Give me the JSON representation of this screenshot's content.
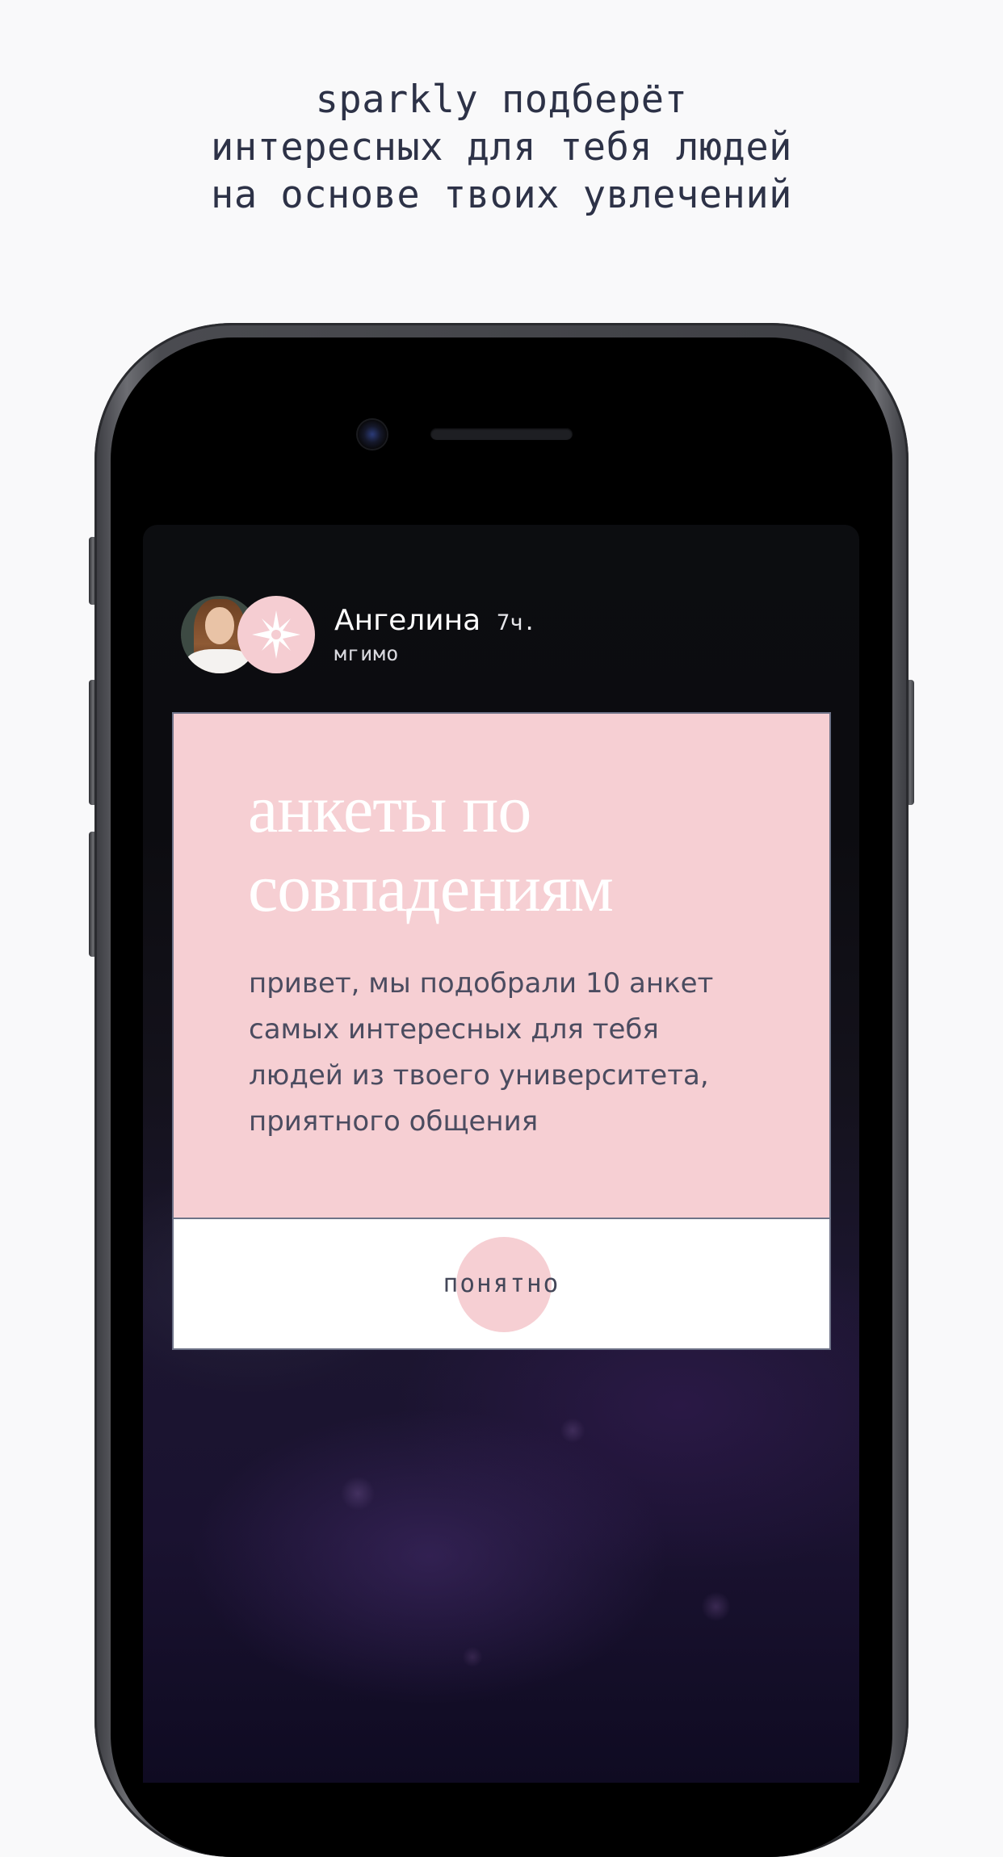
{
  "caption": {
    "line1": "sparkly подберёт",
    "line2": "интересных для тебя людей",
    "line3": "на основе твоих увлечений"
  },
  "post": {
    "author_name": "Ангелина",
    "time": "7ч.",
    "university": "мгимо",
    "avatar_icon": "user-photo",
    "badge_icon": "sparkle-star-icon"
  },
  "card": {
    "title_line1": "анкеты по",
    "title_line2": "совпадениям",
    "text_line1": "привет, мы подобрали 10 анкет",
    "text_line2": "самых интересных для тебя",
    "text_line3": "людей из твоего университета,",
    "text_line4": "приятного общения",
    "button_label": "понятно"
  },
  "colors": {
    "background": "#f9f9fa",
    "caption_text": "#2d3247",
    "card_pink": "#f6cfd3",
    "card_text": "#4b4c60",
    "card_border": "#6e7388"
  }
}
